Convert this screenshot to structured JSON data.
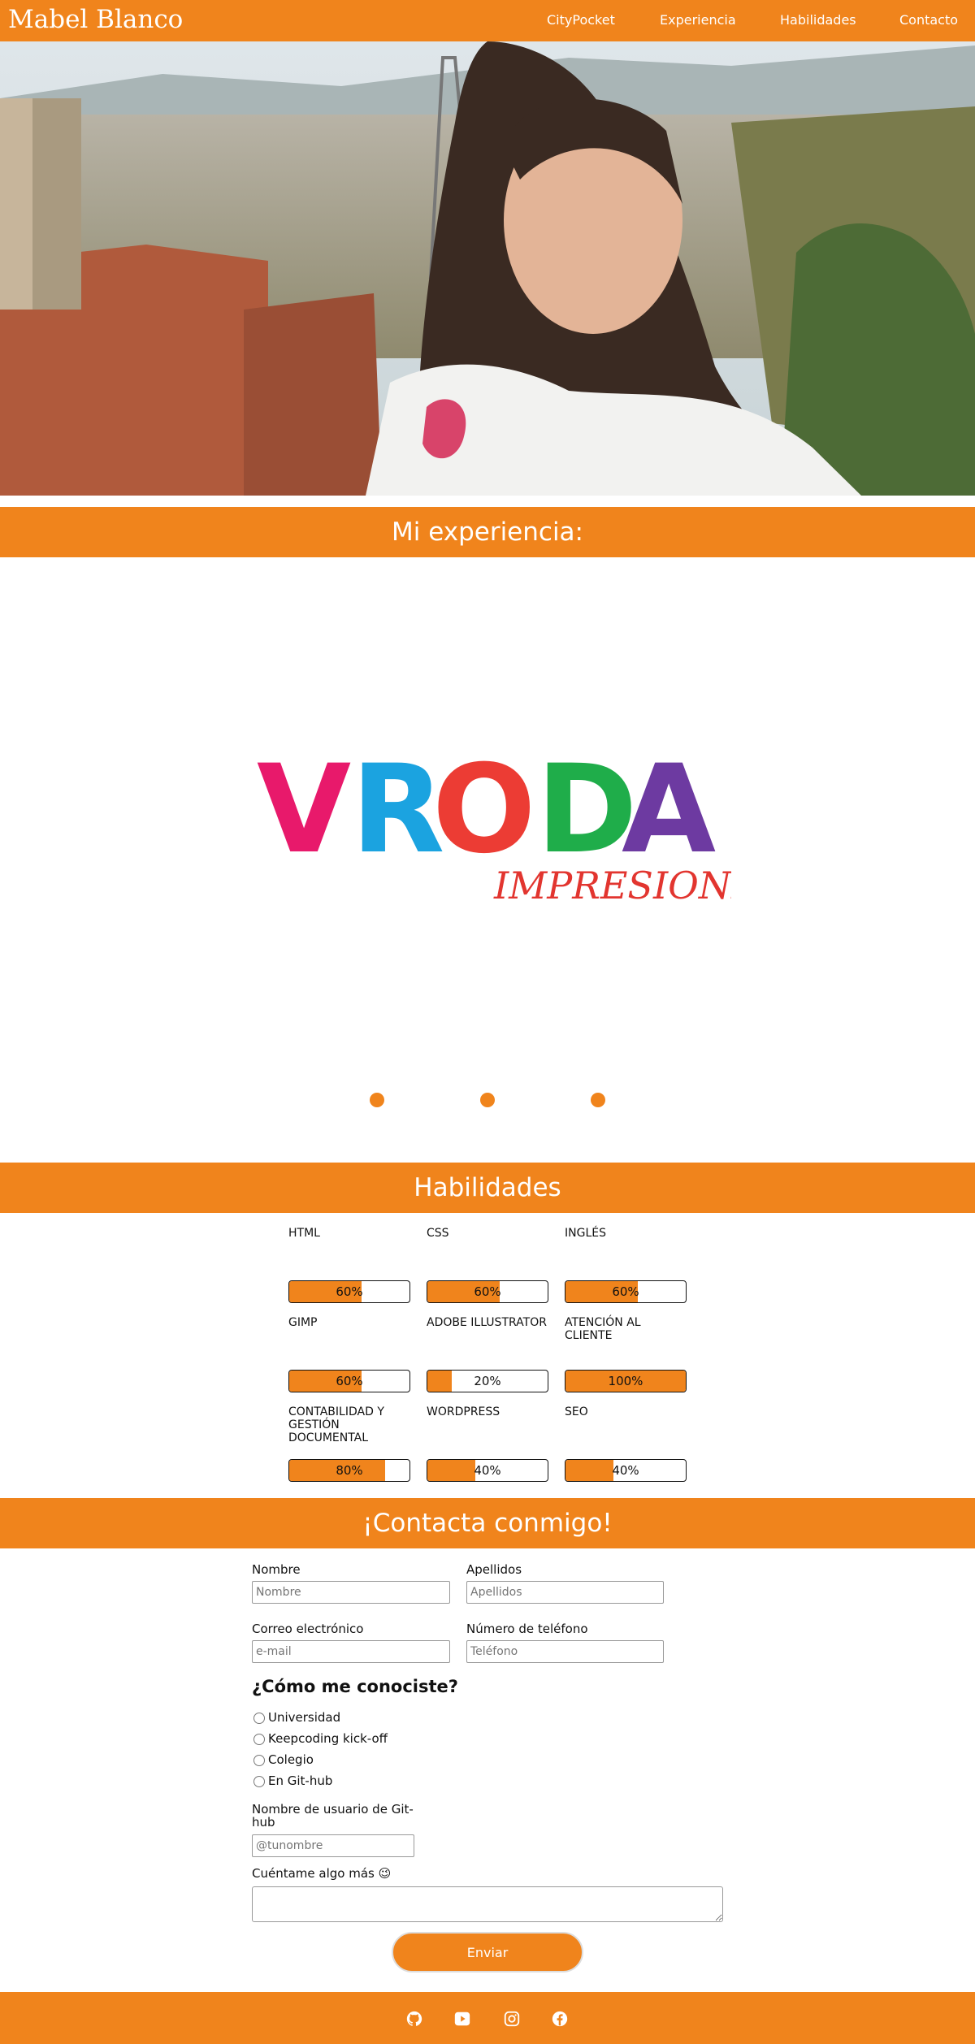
{
  "header": {
    "brand": "Mabel Blanco",
    "nav": [
      "CityPocket",
      "Experiencia",
      "Habilidades",
      "Contacto"
    ]
  },
  "hero": {
    "alt_desc_icon": "hero-photo"
  },
  "experience": {
    "title": "Mi experiencia:",
    "logo_main": "VRODA",
    "logo_sub": "IMPRESIONES",
    "logo_colors": [
      "#e8196b",
      "#1ba3e0",
      "#ec3c34",
      "#1fad4a",
      "#6d3aa1"
    ]
  },
  "skills": {
    "title": "Habilidades",
    "items": [
      {
        "name": "HTML",
        "level": 60,
        "label": "60%"
      },
      {
        "name": "CSS",
        "level": 60,
        "label": "60%"
      },
      {
        "name": "INGLÉS",
        "level": 60,
        "label": "60%"
      },
      {
        "name": "GIMP",
        "level": 60,
        "label": "60%"
      },
      {
        "name": "ADOBE ILLUSTRATOR",
        "level": 20,
        "label": "20%"
      },
      {
        "name": "ATENCIÓN AL CLIENTE",
        "level": 100,
        "label": "100%"
      },
      {
        "name": "CONTABILIDAD Y GESTIÓN DOCUMENTAL",
        "level": 80,
        "label": "80%"
      },
      {
        "name": "WORDPRESS",
        "level": 40,
        "label": "40%"
      },
      {
        "name": "SEO",
        "level": 40,
        "label": "40%"
      }
    ]
  },
  "contact": {
    "title": "¡Contacta conmigo!",
    "nombre_label": "Nombre",
    "nombre_placeholder": "Nombre",
    "apellidos_label": "Apellidos",
    "apellidos_placeholder": "Apellidos",
    "email_label": "Correo electrónico",
    "email_placeholder": "e-mail",
    "phone_label": "Número de teléfono",
    "phone_placeholder": "Teléfono",
    "how_title": "¿Cómo me conociste?",
    "options": [
      "Universidad",
      "Keepcoding kick-off",
      "Colegio",
      "En Git-hub"
    ],
    "github_label": "Nombre de usuario de Git-hub",
    "github_placeholder": "@tunombre",
    "more_label": "Cuéntame algo más 😉",
    "submit": "Enviar"
  },
  "footer": {
    "icons": [
      "github-icon",
      "youtube-icon",
      "instagram-icon",
      "facebook-icon"
    ]
  },
  "colors": {
    "accent": "#f0841c"
  }
}
